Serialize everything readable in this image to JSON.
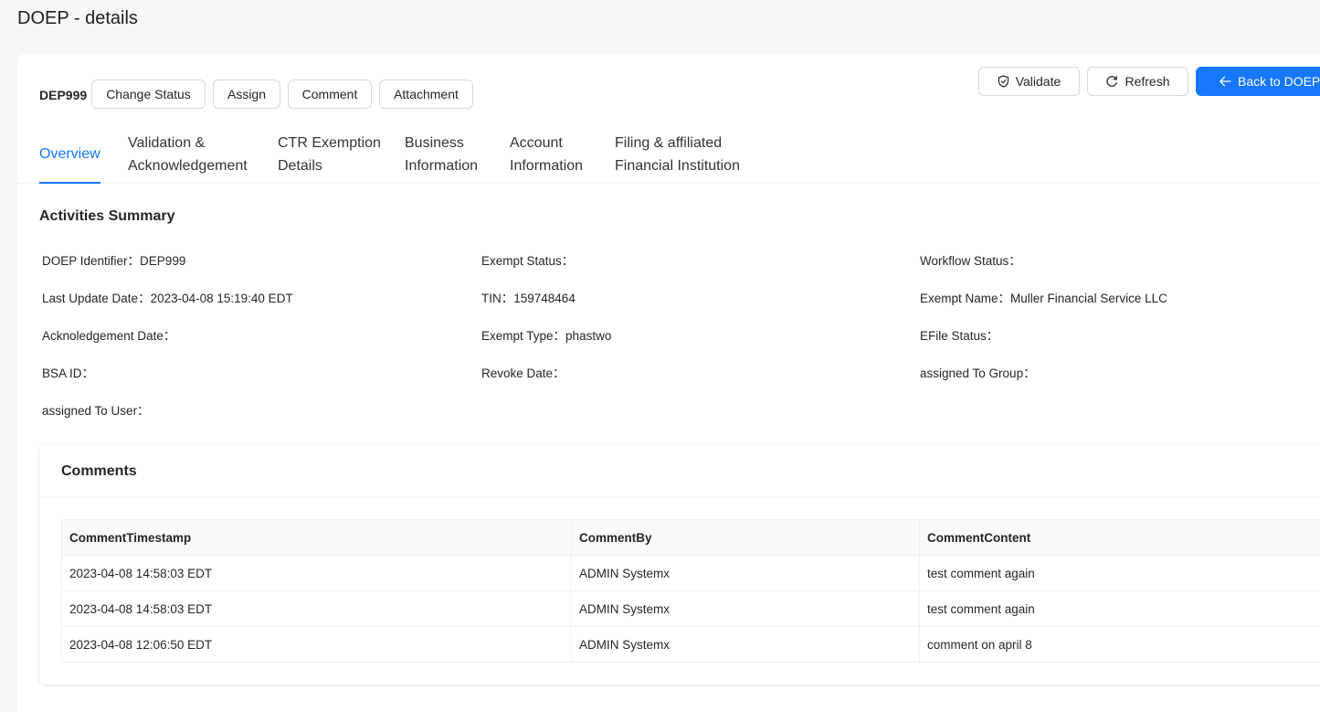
{
  "page": {
    "title": "DOEP - details"
  },
  "toolbar": {
    "record_id": "DEP999",
    "change_status": "Change Status",
    "assign": "Assign",
    "comment": "Comment",
    "attachment": "Attachment",
    "validate": "Validate",
    "refresh": "Refresh",
    "back": "Back to DOEP"
  },
  "tabs": [
    {
      "line1": "Overview",
      "line2": ""
    },
    {
      "line1": "Validation &",
      "line2": "Acknowledgement"
    },
    {
      "line1": "CTR Exemption",
      "line2": "Details"
    },
    {
      "line1": "Business",
      "line2": "Information"
    },
    {
      "line1": "Account",
      "line2": "Information"
    },
    {
      "line1": "Filing & affiliated",
      "line2": "Financial Institution"
    }
  ],
  "summary": {
    "title": "Activities Summary",
    "fields": [
      {
        "label": "DOEP Identifier：",
        "value": "DEP999"
      },
      {
        "label": "Exempt Status：",
        "value": ""
      },
      {
        "label": "Workflow Status：",
        "value": ""
      },
      {
        "label": "Last Update Date：",
        "value": "2023-04-08 15:19:40 EDT"
      },
      {
        "label": "TIN：",
        "value": "159748464"
      },
      {
        "label": "Exempt Name：",
        "value": "Muller Financial Service LLC"
      },
      {
        "label": "Acknoledgement Date：",
        "value": ""
      },
      {
        "label": "Exempt Type：",
        "value": "phastwo"
      },
      {
        "label": "EFile Status：",
        "value": ""
      },
      {
        "label": "BSA ID：",
        "value": ""
      },
      {
        "label": "Revoke Date：",
        "value": ""
      },
      {
        "label": "assigned To Group：",
        "value": ""
      },
      {
        "label": "assigned To User：",
        "value": ""
      }
    ]
  },
  "comments": {
    "title": "Comments",
    "columns": [
      "CommentTimestamp",
      "CommentBy",
      "CommentContent"
    ],
    "rows": [
      [
        "2023-04-08 14:58:03 EDT",
        "ADMIN Systemx",
        "test comment again"
      ],
      [
        "2023-04-08 14:58:03 EDT",
        "ADMIN Systemx",
        "test comment again"
      ],
      [
        "2023-04-08 12:06:50 EDT",
        "ADMIN Systemx",
        "comment on april 8"
      ]
    ]
  },
  "colors": {
    "primary": "#1677ff",
    "border": "#d9d9d9",
    "page_bg": "#f7f7f7"
  },
  "icons": {
    "validate": "shield-check-icon",
    "refresh": "refresh-icon",
    "back": "arrow-left-icon"
  }
}
